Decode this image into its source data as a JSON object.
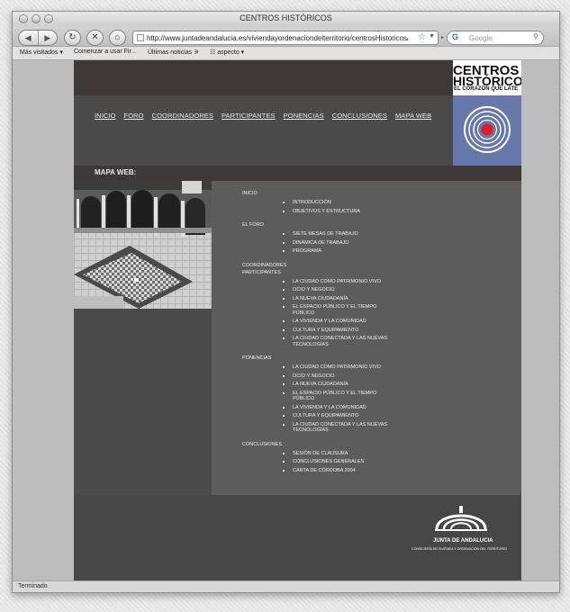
{
  "browser": {
    "window_title": "CENTROS HISTÓRICOS",
    "url": "http://www.juntadeandalucia.es/viviendayordenaciondelterritorio/centrosHistoricos/in",
    "search_placeholder": "Google",
    "status": "Terminado",
    "bookmarks": [
      "Más visitados ▾",
      "Comenzar a usar Fir...",
      "Últimas noticias ⚞",
      "☷ aspecto ▾"
    ]
  },
  "site": {
    "logo_line1": "CENTROS",
    "logo_line2": "HISTÓRICOS",
    "logo_tagline": "EL CORAZÓN QUE LATE",
    "nav": [
      "INICIO",
      "FORO",
      "COORDINADORES",
      "PARTICIPANTES",
      "PONENCIAS",
      "CONCLUSIONES",
      "MAPA WEB"
    ],
    "section_title": "MAPA WEB:",
    "sitemap": {
      "inicio": {
        "title": "INICIO",
        "items": [
          "INTRODUCCIÓN",
          "OBJETIVOS Y ESTRUCTURA"
        ]
      },
      "foro": {
        "title": "EL FORO",
        "items": [
          "SIETE MESAS DE TRABAJO",
          "DINÁMICA DE TRABAJO",
          "PROGRAMA"
        ]
      },
      "coordinadores": {
        "title": "COORDINADORES"
      },
      "participantes": {
        "title": "PARTICIPANTES",
        "items": [
          "LA CIUDAD COMO PATRIMONIO VIVO",
          "OCIO Y NEGOCIO",
          "LA NUEVA CIUDADANÍA",
          "EL ESPACIO PÚBLICO Y EL TIEMPO PÚBLICO",
          "LA VIVIENDA Y LA COMUNIDAD",
          "CULTURA Y EQUIPAMIENTO",
          "LA CIUDAD CONECTADA Y LAS NUEVAS TECNOLOGÍAS"
        ]
      },
      "ponencias": {
        "title": "PONENCIAS",
        "items": [
          "LA CIUDAD COMO PATRIMONIO VIVO",
          "OCIO Y NEGOCIO",
          "LA NUEVA CIUDADANÍA",
          "EL ESPACIO PÚBLICO Y EL TIEMPO PÚBLICO",
          "LA VIVIENDA Y LA COMUNIDAD",
          "CULTURA Y EQUIPAMIENTO",
          "LA CIUDAD CONECTADA Y LAS NUEVAS TECNOLOGÍAS"
        ]
      },
      "conclusiones": {
        "title": "CONCLUSIONES",
        "items": [
          "SESIÓN DE CLAUSURA",
          "CONCLUSIONES GENERALES",
          "CARTA DE CÓRDOBA 2004"
        ]
      }
    },
    "footer_logo_line1": "JUNTA DE ANDALUCIA",
    "footer_logo_line2": "CONSEJERÍA DE VIVIENDA Y ORDENACIÓN DEL TERRITORIO"
  }
}
